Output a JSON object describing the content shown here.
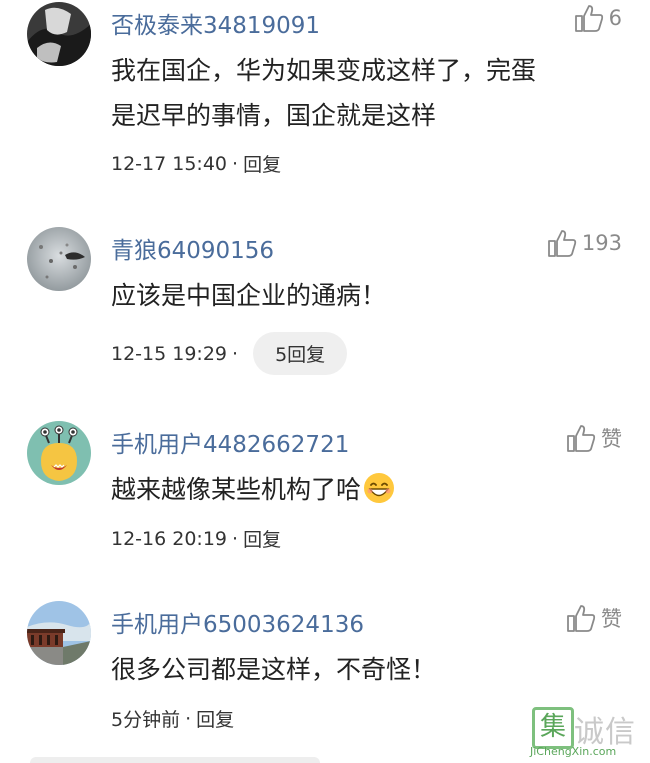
{
  "comments": [
    {
      "username": "否极泰来34819091",
      "like_count": "6",
      "text_lines": [
        "我在国企，华为如果变成这样了，完蛋",
        "是迟早的事情，国企就是这样"
      ],
      "time": "12-17 15:40",
      "reply_label": "回复",
      "dot": "·"
    },
    {
      "username": "青狼64090156",
      "like_count": "193",
      "text_lines": [
        "应该是中国企业的通病！"
      ],
      "time": "12-15 19:29",
      "reply_label": "5回复",
      "dot": "·"
    },
    {
      "username": "手机用户4482662721",
      "like_count": "赞",
      "text_lines": [
        "越来越像某些机构了哈"
      ],
      "time": "12-16 20:19",
      "reply_label": "回复",
      "dot": "·"
    },
    {
      "username": "手机用户65003624136",
      "like_count": "赞",
      "text_lines": [
        "很多公司都是这样，不奇怪！"
      ],
      "time": "5分钟前",
      "reply_label": "回复",
      "dot": "·"
    }
  ],
  "watermark": {
    "box_char": "集",
    "chars": "诚信",
    "url": "JiChengXin.com"
  },
  "icons": {
    "like": "thumbs-up-icon",
    "emoji": "grinning-face-emoji"
  }
}
